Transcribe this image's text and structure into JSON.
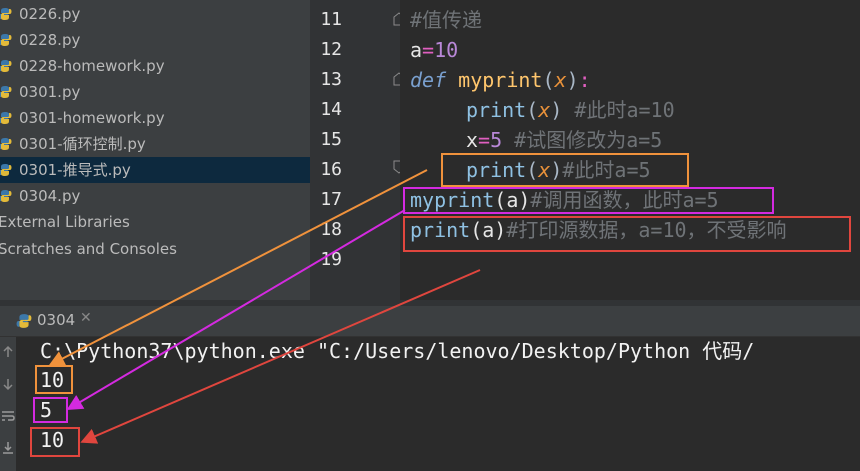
{
  "project_tree": {
    "files": [
      {
        "name": "0226.py",
        "selected": false
      },
      {
        "name": "0228.py",
        "selected": false
      },
      {
        "name": "0228-homework.py",
        "selected": false
      },
      {
        "name": "0301.py",
        "selected": false
      },
      {
        "name": "0301-homework.py",
        "selected": false
      },
      {
        "name": "0301-循环控制.py",
        "selected": false
      },
      {
        "name": "0301-推导式.py",
        "selected": true
      },
      {
        "name": "0304.py",
        "selected": false
      }
    ],
    "external_libraries": "External Libraries",
    "scratches": "Scratches and Consoles"
  },
  "editor": {
    "line_numbers": [
      "11",
      "12",
      "13",
      "14",
      "15",
      "16",
      "17",
      "18",
      "19"
    ],
    "line11": {
      "comment": "#值传递"
    },
    "line12": {
      "var": "a",
      "op": "=",
      "num": "10"
    },
    "line13": {
      "kw": "def",
      "fn": "myprint",
      "paren_open": "(",
      "param": "x",
      "paren_close": ")",
      "colon": ":"
    },
    "line14": {
      "builtin": "print",
      "paren_open": "(",
      "arg": "x",
      "paren_close": ")",
      "comment": " #此时a=10"
    },
    "line15": {
      "var": "x",
      "op": "=",
      "num": "5",
      "comment": " #试图修改为a=5"
    },
    "line16": {
      "builtin": "print",
      "paren_open": "(",
      "arg": "x",
      "paren_close": ")",
      "comment": "#此时a=5"
    },
    "line17": {
      "call": "myprint",
      "args": "(a)",
      "comment": "#调用函数，此时a=5"
    },
    "line18": {
      "builtin": "print",
      "args": "(a)",
      "comment": "#打印源数据，a=10，不受影响"
    }
  },
  "run_panel": {
    "tab_label": "0304",
    "command": "C:\\Python37\\python.exe \"C:/Users/lenovo/Desktop/Python 代码/",
    "output": [
      "10",
      "5",
      "10"
    ]
  },
  "annotations": {
    "colors": {
      "orange": "#f0923c",
      "magenta": "#d42ae0",
      "red": "#e0463e"
    }
  }
}
